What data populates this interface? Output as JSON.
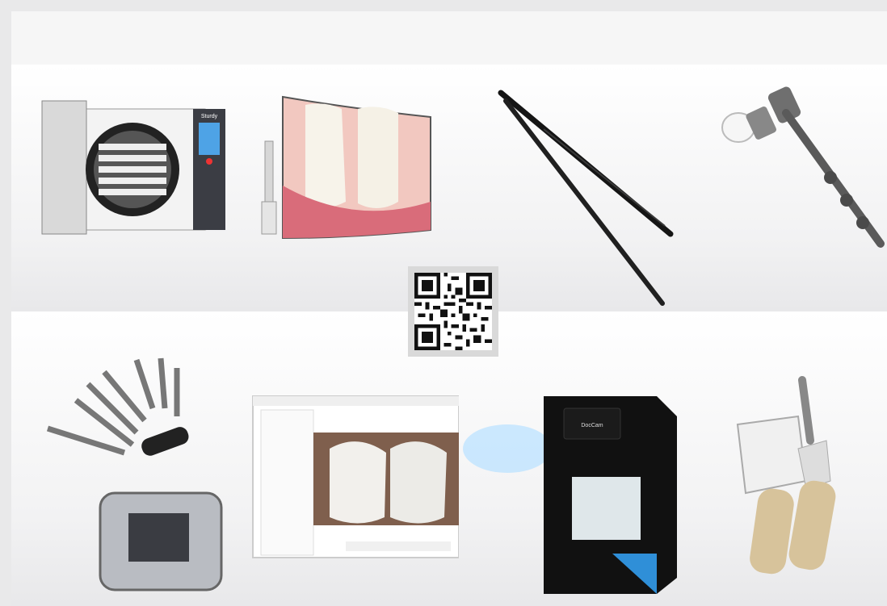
{
  "products": [
    {
      "name": "autoclave-sterilizer",
      "brand_label": "Sturdy"
    },
    {
      "name": "intraoral-camera-display"
    },
    {
      "name": "dental-tweezers"
    },
    {
      "name": "dental-hammer-instrument"
    },
    {
      "name": "orthodontic-mini-implants-and-bracket"
    },
    {
      "name": "dental-cad-software"
    },
    {
      "name": "dental-milling-machine",
      "brand_label": "DocCam"
    },
    {
      "name": "handheld-intraoral-scanner"
    }
  ],
  "qr_code": {
    "icon": "qr-code"
  },
  "colors": {
    "background": "#e9e9ea",
    "qr_frame": "#d9d9d9",
    "accent_blue": "#2f8fd8"
  }
}
